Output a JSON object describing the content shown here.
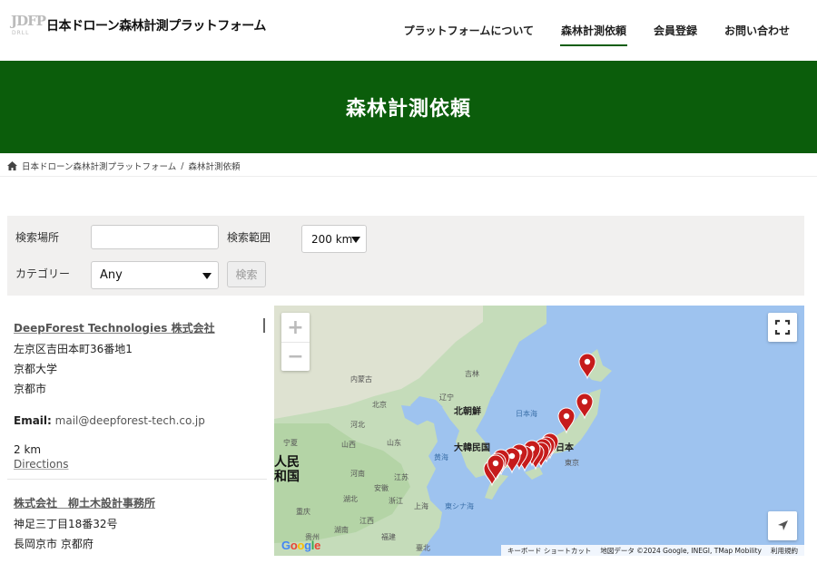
{
  "site": {
    "logo_mark": "JDFP",
    "logo_sub": "DRLL",
    "title": "日本ドローン森林計測プラットフォーム"
  },
  "nav": [
    {
      "label": "プラットフォームについて"
    },
    {
      "label": "森林計測依頼"
    },
    {
      "label": "会員登録"
    },
    {
      "label": "お問い合わせ"
    }
  ],
  "hero": {
    "title": "森林計測依頼"
  },
  "breadcrumb": {
    "home": "日本ドローン森林計測プラットフォーム",
    "separator": "/",
    "current": "森林計測依頼"
  },
  "search": {
    "location_label": "検索場所",
    "location_value": "",
    "range_label": "検索範囲",
    "range_value": "200 km",
    "category_label": "カテゴリー",
    "category_value": "Any",
    "search_button": "検索"
  },
  "results": [
    {
      "name": "DeepForest Technologies 株式会社",
      "address1": "左京区吉田本町36番地1",
      "address2": "京都大学",
      "address3": "京都市",
      "email_label": "Email:",
      "email": "mail@deepforest-tech.co.jp",
      "distance": "2 km",
      "directions": "Directions"
    },
    {
      "name": "株式会社　柳土木設計事務所",
      "address1": "神足三丁目18番32号",
      "address2": "長岡京市 京都府"
    }
  ],
  "map": {
    "zoom_in": "+",
    "zoom_out": "−",
    "google": [
      "G",
      "o",
      "o",
      "g",
      "l",
      "e"
    ],
    "google_colors": [
      "#4285F4",
      "#EA4335",
      "#FBBC05",
      "#4285F4",
      "#34A853",
      "#EA4335"
    ],
    "attribution": [
      "キーボード ショートカット",
      "地図データ ©2024 Google, INEGI, TMap Mobility",
      "利用規約"
    ],
    "labels": {
      "n_korea": "北朝鮮",
      "s_korea": "大韓民国",
      "japan": "日本",
      "tokyo": "東京",
      "sea_of_japan": "日本海",
      "yellow_sea": "黄海",
      "east_china_sea": "東シナ海",
      "beijing": "北京",
      "shanghai": "上海",
      "inner_mongolia": "内蒙古",
      "jilin": "吉林",
      "liaoning": "辽宁",
      "ningxia": "宁夏",
      "shanxi": "山西",
      "shandong": "山东",
      "jiangsu": "江苏",
      "anhui": "安徽",
      "henan": "河南",
      "hubei": "湖北",
      "hunan": "湖南",
      "zhejiang": "浙江",
      "jiangxi": "江西",
      "chongqing": "重庆",
      "guizhou": "贵州",
      "fujian": "福建",
      "taiwan": "臺北",
      "hebei": "河北",
      "partial_label1": "人民",
      "partial_label2": "和国"
    },
    "marker_color": "#c61b1b",
    "marker_count": 16
  }
}
